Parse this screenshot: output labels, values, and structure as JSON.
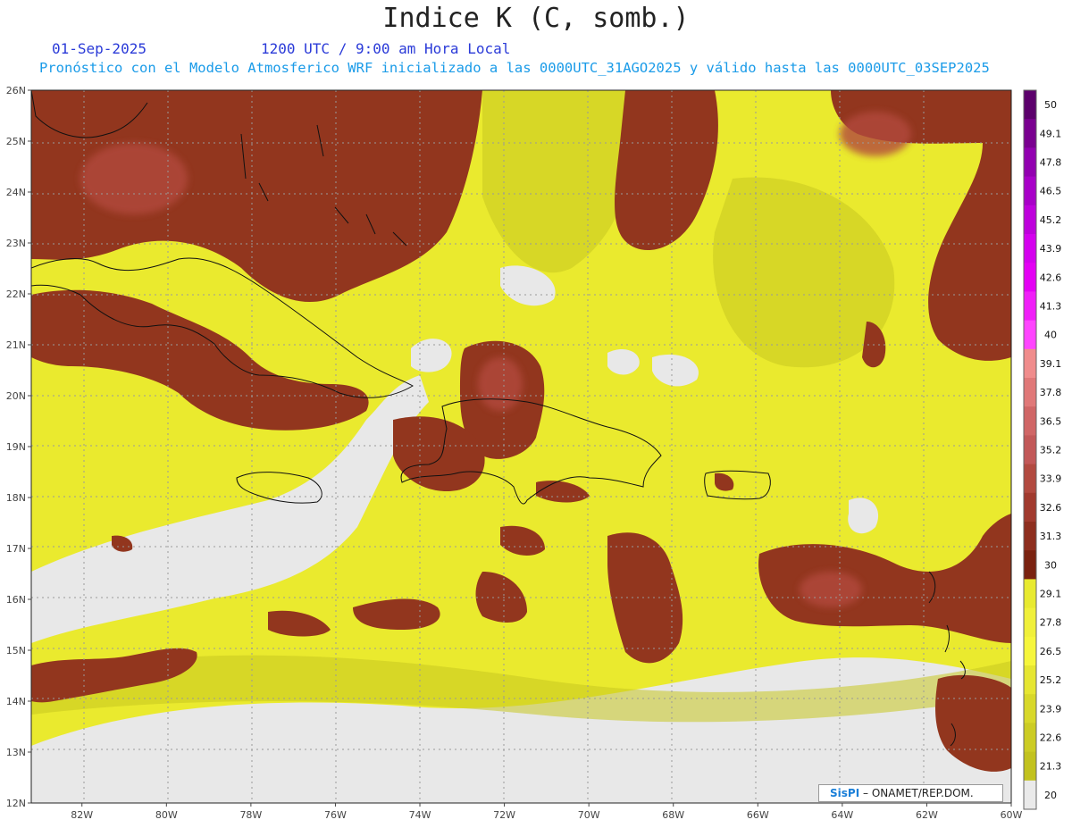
{
  "header": {
    "title": "Indice K (C, somb.)",
    "date": "01-Sep-2025",
    "time": "1200 UTC / 9:00 am Hora Local",
    "forecast": "Pronóstico con el Modelo Atmosferico WRF inicializado a las 0000UTC_31AGO2025 y válido hasta las  0000UTC_03SEP2025"
  },
  "map": {
    "lat_labels": [
      "26N",
      "25N",
      "24N",
      "23N",
      "22N",
      "21N",
      "20N",
      "19N",
      "18N",
      "17N",
      "16N",
      "15N",
      "14N",
      "13N",
      "12N"
    ],
    "lon_labels": [
      "82W",
      "80W",
      "78W",
      "76W",
      "74W",
      "72W",
      "70W",
      "68W",
      "66W",
      "64W",
      "62W",
      "60W"
    ],
    "lat_range": [
      12,
      26
    ],
    "lon_range": [
      -83.2,
      -60
    ],
    "grid": true
  },
  "colorbar": {
    "labels": [
      "50",
      "49.1",
      "47.8",
      "46.5",
      "45.2",
      "43.9",
      "42.6",
      "41.3",
      "40",
      "39.1",
      "37.8",
      "36.5",
      "35.2",
      "33.9",
      "32.6",
      "31.3",
      "30",
      "29.1",
      "27.8",
      "26.5",
      "25.2",
      "23.9",
      "22.6",
      "21.3",
      "20"
    ],
    "colors": [
      "#5c006c",
      "#7a0090",
      "#9200b0",
      "#a800c8",
      "#be00dc",
      "#d400ee",
      "#e400f4",
      "#f01ef8",
      "#ff44ff",
      "#f08c8c",
      "#e07878",
      "#d06666",
      "#c25858",
      "#b24a40",
      "#a13a2e",
      "#8e2e1e",
      "#7a2210",
      "#e8ea30",
      "#f0f03a",
      "#f6f63c",
      "#e6e632",
      "#d8d82a",
      "#cccc24",
      "#c2c21e",
      "#eaeaea"
    ]
  },
  "credit": {
    "brand": "SisPI",
    "org": "– ONAMET/REP.DOM."
  }
}
